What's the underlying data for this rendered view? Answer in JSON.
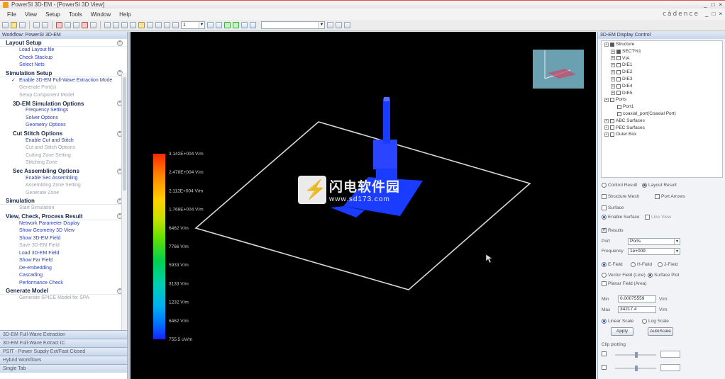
{
  "window": {
    "title": "PowerSI 3D-EM - [PowerSI 3D View]",
    "controls": [
      "_",
      "□",
      "×"
    ]
  },
  "menu": {
    "items": [
      "File",
      "View",
      "Setup",
      "Tools",
      "Window",
      "Help"
    ],
    "brand": "cādence"
  },
  "toolbar": {
    "combo_value": "1",
    "combo_wide_value": ""
  },
  "left_panel": {
    "header": "Workflow: PowerSI 3D-EM",
    "sections": [
      {
        "title": "Layout Setup",
        "items": [
          {
            "label": "Load Layout file",
            "state": "enabled"
          },
          {
            "label": "Check Stackup",
            "state": "enabled"
          },
          {
            "label": "Select Nets",
            "state": "enabled"
          }
        ]
      },
      {
        "title": "Simulation Setup",
        "items": [
          {
            "label": "Enable 3D-EM Full-Wave Extraction Mode",
            "state": "checked"
          },
          {
            "label": "Generate Port(s)",
            "state": "disabled"
          },
          {
            "label": "Setup Component Model",
            "state": "disabled"
          }
        ]
      },
      {
        "title": "3D-EM Simulation Options",
        "sub": true,
        "items": [
          {
            "label": "Frequency Settings",
            "state": "enabled"
          },
          {
            "label": "Solver Options",
            "state": "enabled"
          },
          {
            "label": "Geometry Options",
            "state": "enabled"
          }
        ]
      },
      {
        "title": "Cut Stitch Options",
        "sub": true,
        "items": [
          {
            "label": "Enable Cut and Stitch",
            "state": "enabled"
          },
          {
            "label": "Cut and Stitch Options",
            "state": "disabled"
          },
          {
            "label": "Cutting Zone Setting",
            "state": "disabled"
          },
          {
            "label": "Stitching Zone",
            "state": "disabled"
          }
        ]
      },
      {
        "title": "Sec Assembling Options",
        "sub": true,
        "items": [
          {
            "label": "Enable Sec Assembling",
            "state": "enabled"
          },
          {
            "label": "Assembling Zone Setting",
            "state": "disabled"
          },
          {
            "label": "Generate Zone",
            "state": "disabled"
          }
        ]
      },
      {
        "title": "Simulation",
        "items": [
          {
            "label": "Start Simulation",
            "state": "disabled"
          }
        ]
      },
      {
        "title": "View, Check, Process Result",
        "items": [
          {
            "label": "Network Parameter Display",
            "state": "enabled"
          },
          {
            "label": "Show Geometry 3D View",
            "state": "enabled"
          },
          {
            "label": "Show 3D-EM Field",
            "state": "enabled"
          },
          {
            "label": "Save 3D-EM Field",
            "state": "disabled"
          },
          {
            "label": "Load 3D-EM Field",
            "state": "enabled"
          },
          {
            "label": "Show Far Field",
            "state": "enabled"
          },
          {
            "label": "De-embedding",
            "state": "enabled"
          },
          {
            "label": "Cascading",
            "state": "enabled"
          },
          {
            "label": "Performance Check",
            "state": "enabled"
          }
        ]
      },
      {
        "title": "Generate Model",
        "items": [
          {
            "label": "Generate SPICE Model for SPA",
            "state": "disabled"
          }
        ]
      }
    ],
    "bottom_tabs": [
      "3D-EM Full-Wave Extraction",
      "3D-EM Full-Wave Extract IC",
      "PSIT - Power Supply Ext/Fast Closed",
      "Hybrid Workflows",
      "Single Tab"
    ]
  },
  "viewport": {
    "legend_labels": [
      "3.142E+004 V/m",
      "2.478E+004 V/m",
      "2.112E+004 V/m",
      "1.768E+004 V/m",
      "6462 V/m",
      "7766 V/m",
      "5933 V/m",
      "3133 V/m",
      "1232 V/m",
      "6462 V/m",
      "755.5 uV/m"
    ],
    "legend_colors": [
      "#ff2a00",
      "#ff8800",
      "#ffd000",
      "#c8e000",
      "#66e000",
      "#00d050",
      "#00d0b0",
      "#00b0f0",
      "#0070ff",
      "#0040ff",
      "#1a20ff"
    ],
    "board_color": "#1a3cff",
    "outline_color": "#d8d8d8",
    "minimap_color": "#6aa0b0"
  },
  "right_panel": {
    "header": "3D-EM Display Control",
    "tree": [
      {
        "label": "Structure",
        "level": 0,
        "check": "on"
      },
      {
        "label": "SECT%1",
        "level": 1,
        "check": "on"
      },
      {
        "label": "VIA",
        "level": 1,
        "check": "off"
      },
      {
        "label": "DIE1",
        "level": 1,
        "check": "off"
      },
      {
        "label": "DIE2",
        "level": 1,
        "check": "off"
      },
      {
        "label": "DIE3",
        "level": 1,
        "check": "off"
      },
      {
        "label": "DIE4",
        "level": 1,
        "check": "off"
      },
      {
        "label": "DIE5",
        "level": 1,
        "check": "off"
      },
      {
        "label": "Ports",
        "level": 0,
        "check": "off"
      },
      {
        "label": "Port1",
        "level": 2,
        "check": "off"
      },
      {
        "label": "coaxial_port(Coaxial Port)",
        "level": 2,
        "check": "off"
      },
      {
        "label": "ABC Surfaces",
        "level": 0,
        "check": "off"
      },
      {
        "label": "PEC Surfaces",
        "level": 0,
        "check": "off"
      },
      {
        "label": "Outer Box",
        "level": 0,
        "check": "off"
      }
    ],
    "mode_radios": [
      "Control Result",
      "Layout Result"
    ],
    "checks": {
      "structure_mesh": "Structure Mesh",
      "port_arrows": "Port Arrows",
      "surface": "Surface",
      "enable_surface": "Enable Surface",
      "line_view": "Line View",
      "results": "Results"
    },
    "port_label": "Port",
    "port_value": "Ports",
    "freq_label": "Frequency",
    "freq_value": "1e+009",
    "field_radios": [
      "E-Field",
      "H-Field",
      "J-Field"
    ],
    "view_radios": [
      "Vector Field (Line)",
      "Surface Plot"
    ],
    "planar_check": "Planar Field (Area)",
    "min_label": "Min",
    "min_value": "0.00075559",
    "min_unit": "V/m",
    "max_label": "Max",
    "max_value": "34217.4",
    "max_unit": "V/m",
    "scale_radios": [
      "Linear Scale",
      "Log Scale"
    ],
    "apply_label": "Apply",
    "autoscale_label": "AutoScale",
    "clip_label": "Clip plotting"
  }
}
